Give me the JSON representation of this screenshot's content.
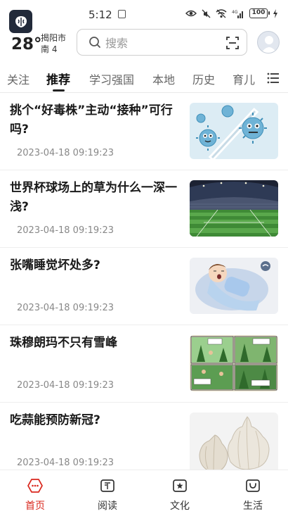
{
  "status_bar": {
    "time": "5:12",
    "battery": "100"
  },
  "weather": {
    "temperature": "28°",
    "city": "揭阳市",
    "wind": "南 4"
  },
  "search": {
    "placeholder": "搜索"
  },
  "tabs": [
    {
      "label": "关注",
      "active": false
    },
    {
      "label": "推荐",
      "active": true
    },
    {
      "label": "学习强国",
      "active": false
    },
    {
      "label": "本地",
      "active": false
    },
    {
      "label": "历史",
      "active": false
    },
    {
      "label": "育儿",
      "active": false
    }
  ],
  "news": [
    {
      "title": "挑个“好毒株”主动“接种”可行吗?",
      "time": "2023-04-18 09:19:23",
      "thumb": "virus"
    },
    {
      "title": "世界杯球场上的草为什么一深一浅?",
      "time": "2023-04-18 09:19:23",
      "thumb": "stadium"
    },
    {
      "title": "张嘴睡觉坏处多?",
      "time": "2023-04-18 09:19:23",
      "thumb": "sleep"
    },
    {
      "title": "珠穆朗玛不只有雪峰",
      "time": "2023-04-18 09:19:23",
      "thumb": "comic"
    },
    {
      "title": "吃蒜能预防新冠?",
      "time": "2023-04-18 09:19:23",
      "thumb": "garlic"
    }
  ],
  "bottom_nav": [
    {
      "label": "首页",
      "active": true,
      "icon": "home-icon"
    },
    {
      "label": "阅读",
      "active": false,
      "icon": "book-icon"
    },
    {
      "label": "文化",
      "active": false,
      "icon": "culture-icon"
    },
    {
      "label": "生活",
      "active": false,
      "icon": "life-icon"
    }
  ],
  "colors": {
    "accent": "#d9281e",
    "text": "#1a1a1a",
    "muted": "#888888"
  }
}
